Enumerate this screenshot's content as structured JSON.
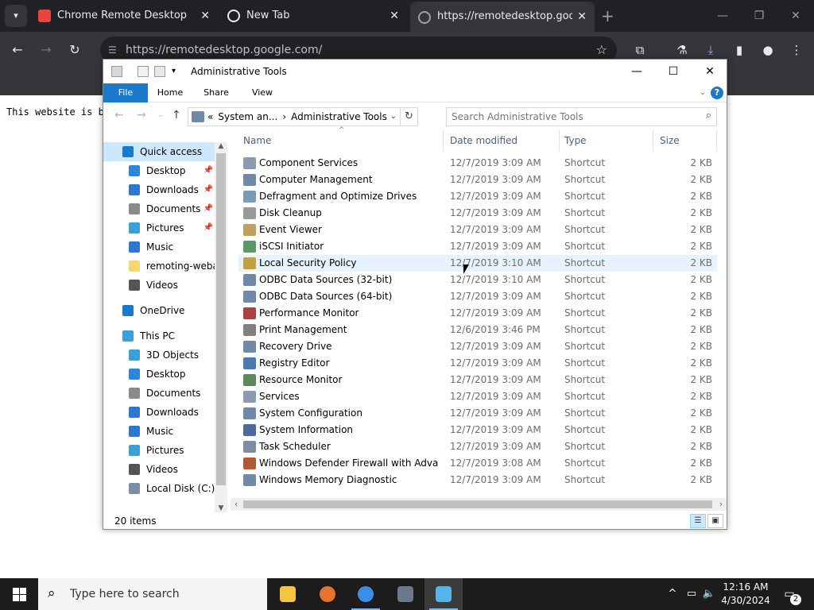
{
  "chrome": {
    "tabs_menu": "▾",
    "tabs": [
      {
        "title": "Chrome Remote Desktop",
        "fav_color": "#e8453c"
      },
      {
        "title": "New Tab",
        "fav_color": "#e8eaed"
      },
      {
        "title": "https://remotedesktop.google.",
        "fav_color": "#9aa0a6"
      }
    ],
    "url": "https://remotedesktop.google.com/",
    "page_text": "This website is b"
  },
  "explorer": {
    "title": "Administrative Tools",
    "ribbon_tabs": [
      "File",
      "Home",
      "Share",
      "View"
    ],
    "breadcrumbs": [
      "«",
      "System an...",
      "›",
      "Administrative Tools"
    ],
    "search_placeholder": "Search Administrative Tools",
    "nav": [
      {
        "label": "Quick access",
        "level": 0,
        "pinned": false,
        "selected": true,
        "color": "#1979ca"
      },
      {
        "label": "Desktop",
        "level": 1,
        "pinned": true,
        "selected": false,
        "color": "#2b88d8"
      },
      {
        "label": "Downloads",
        "level": 1,
        "pinned": true,
        "selected": false,
        "color": "#2b79d0"
      },
      {
        "label": "Documents",
        "level": 1,
        "pinned": true,
        "selected": false,
        "color": "#8a8a8a"
      },
      {
        "label": "Pictures",
        "level": 1,
        "pinned": true,
        "selected": false,
        "color": "#3aa0d8"
      },
      {
        "label": "Music",
        "level": 1,
        "pinned": false,
        "selected": false,
        "color": "#2b79d0"
      },
      {
        "label": "remoting-webap",
        "level": 1,
        "pinned": false,
        "selected": false,
        "color": "#f5d76e"
      },
      {
        "label": "Videos",
        "level": 1,
        "pinned": false,
        "selected": false,
        "color": "#555555"
      },
      {
        "label": "OneDrive",
        "level": 0,
        "pinned": false,
        "selected": false,
        "color": "#1979ca"
      },
      {
        "label": "This PC",
        "level": 0,
        "pinned": false,
        "selected": false,
        "color": "#3aa0d8"
      },
      {
        "label": "3D Objects",
        "level": 1,
        "pinned": false,
        "selected": false,
        "color": "#3aa0d8"
      },
      {
        "label": "Desktop",
        "level": 1,
        "pinned": false,
        "selected": false,
        "color": "#2b88d8"
      },
      {
        "label": "Documents",
        "level": 1,
        "pinned": false,
        "selected": false,
        "color": "#8a8a8a"
      },
      {
        "label": "Downloads",
        "level": 1,
        "pinned": false,
        "selected": false,
        "color": "#2b79d0"
      },
      {
        "label": "Music",
        "level": 1,
        "pinned": false,
        "selected": false,
        "color": "#2b79d0"
      },
      {
        "label": "Pictures",
        "level": 1,
        "pinned": false,
        "selected": false,
        "color": "#3aa0d8"
      },
      {
        "label": "Videos",
        "level": 1,
        "pinned": false,
        "selected": false,
        "color": "#555555"
      },
      {
        "label": "Local Disk (C:)",
        "level": 1,
        "pinned": false,
        "selected": false,
        "color": "#7a8fa6"
      }
    ],
    "columns": [
      "Name",
      "Date modified",
      "Type",
      "Size"
    ],
    "files": [
      {
        "name": "Component Services",
        "date": "12/7/2019 3:09 AM",
        "type": "Shortcut",
        "size": "2 KB",
        "color": "#8a9bb0"
      },
      {
        "name": "Computer Management",
        "date": "12/7/2019 3:09 AM",
        "type": "Shortcut",
        "size": "2 KB",
        "color": "#6e8aa8"
      },
      {
        "name": "Defragment and Optimize Drives",
        "date": "12/7/2019 3:09 AM",
        "type": "Shortcut",
        "size": "2 KB",
        "color": "#7a9ab8"
      },
      {
        "name": "Disk Cleanup",
        "date": "12/7/2019 3:09 AM",
        "type": "Shortcut",
        "size": "2 KB",
        "color": "#9a9a9a"
      },
      {
        "name": "Event Viewer",
        "date": "12/7/2019 3:09 AM",
        "type": "Shortcut",
        "size": "2 KB",
        "color": "#c0a060"
      },
      {
        "name": "iSCSI Initiator",
        "date": "12/7/2019 3:09 AM",
        "type": "Shortcut",
        "size": "2 KB",
        "color": "#5a9a6a"
      },
      {
        "name": "Local Security Policy",
        "date": "12/7/2019 3:10 AM",
        "type": "Shortcut",
        "size": "2 KB",
        "color": "#c0a040"
      },
      {
        "name": "ODBC Data Sources (32-bit)",
        "date": "12/7/2019 3:10 AM",
        "type": "Shortcut",
        "size": "2 KB",
        "color": "#6e8aa8"
      },
      {
        "name": "ODBC Data Sources (64-bit)",
        "date": "12/7/2019 3:09 AM",
        "type": "Shortcut",
        "size": "2 KB",
        "color": "#6e8aa8"
      },
      {
        "name": "Performance Monitor",
        "date": "12/7/2019 3:09 AM",
        "type": "Shortcut",
        "size": "2 KB",
        "color": "#b04040"
      },
      {
        "name": "Print Management",
        "date": "12/6/2019 3:46 PM",
        "type": "Shortcut",
        "size": "2 KB",
        "color": "#808080"
      },
      {
        "name": "Recovery Drive",
        "date": "12/7/2019 3:09 AM",
        "type": "Shortcut",
        "size": "2 KB",
        "color": "#6e8aa8"
      },
      {
        "name": "Registry Editor",
        "date": "12/7/2019 3:09 AM",
        "type": "Shortcut",
        "size": "2 KB",
        "color": "#4a7ab0"
      },
      {
        "name": "Resource Monitor",
        "date": "12/7/2019 3:09 AM",
        "type": "Shortcut",
        "size": "2 KB",
        "color": "#5a8a5a"
      },
      {
        "name": "Services",
        "date": "12/7/2019 3:09 AM",
        "type": "Shortcut",
        "size": "2 KB",
        "color": "#8a9bb0"
      },
      {
        "name": "System Configuration",
        "date": "12/7/2019 3:09 AM",
        "type": "Shortcut",
        "size": "2 KB",
        "color": "#6e8aa8"
      },
      {
        "name": "System Information",
        "date": "12/7/2019 3:09 AM",
        "type": "Shortcut",
        "size": "2 KB",
        "color": "#4a6a9a"
      },
      {
        "name": "Task Scheduler",
        "date": "12/7/2019 3:09 AM",
        "type": "Shortcut",
        "size": "2 KB",
        "color": "#7a8fa6"
      },
      {
        "name": "Windows Defender Firewall with Advanc...",
        "date": "12/7/2019 3:08 AM",
        "type": "Shortcut",
        "size": "2 KB",
        "color": "#b05a3a"
      },
      {
        "name": "Windows Memory Diagnostic",
        "date": "12/7/2019 3:09 AM",
        "type": "Shortcut",
        "size": "2 KB",
        "color": "#6e8aa8"
      }
    ],
    "hover_row": 6,
    "status": "20 items"
  },
  "taskbar": {
    "search_text": "Type here to search",
    "apps": [
      {
        "name": "file-explorer",
        "color": "#f5c542",
        "active": false
      },
      {
        "name": "firefox",
        "color": "#e8732e",
        "active": false
      },
      {
        "name": "chrome",
        "color": "#3a8ee6",
        "active": false
      },
      {
        "name": "vscode-like",
        "color": "#6a7a8a",
        "active": false
      },
      {
        "name": "remote-desktop",
        "color": "#56b4e9",
        "active": true
      }
    ],
    "time": "12:16 AM",
    "date": "4/30/2024",
    "notifications": "2"
  }
}
